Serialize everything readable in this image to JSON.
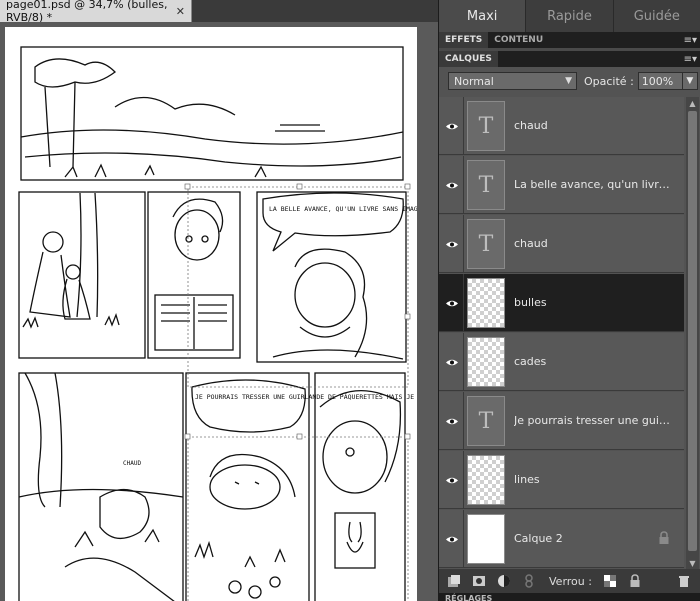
{
  "document": {
    "tab_title": "page01.psd @ 34,7% (bulles, RVB/8) *",
    "close_glyph": "✕",
    "bubbles": [
      "LA BELLE AVANCE, QU'UN LIVRE SANS IMAGES, SANS CAUSERIES !",
      "JE POURRAIS TRESSER UNE GUIRLANDE DE PÂQUERETTES MAIS JE N'AI PAS ENVIE DE ME LEVER..."
    ],
    "caption": "CHAUD"
  },
  "modes": [
    "Maxi",
    "Rapide",
    "Guidée"
  ],
  "effects_tabs": [
    "EFFETS",
    "CONTENU"
  ],
  "layers_panel": {
    "title": "CALQUES",
    "blend_mode": "Normal",
    "opacity_label": "Opacité :",
    "opacity_value": "100%",
    "layers": [
      {
        "name": "chaud",
        "type": "text",
        "selected": false
      },
      {
        "name": "La belle avance, qu'un livre sa...",
        "type": "text",
        "selected": false
      },
      {
        "name": "chaud",
        "type": "text",
        "selected": false
      },
      {
        "name": "bulles",
        "type": "transparent",
        "selected": true
      },
      {
        "name": "cades",
        "type": "transparent",
        "selected": false
      },
      {
        "name": "Je pourrais tresser une guirlan...",
        "type": "text",
        "selected": false
      },
      {
        "name": "lines",
        "type": "transparent",
        "selected": false
      },
      {
        "name": "Calque 2",
        "type": "white",
        "selected": false,
        "locked": true
      }
    ],
    "lock_label": "Verrou :"
  },
  "bottom_panel": {
    "title": "RÉGLAGES"
  },
  "colors": {
    "selected_row": "#1f1f1f",
    "panel_bg": "#535353",
    "accent": "#e8e8e8"
  }
}
